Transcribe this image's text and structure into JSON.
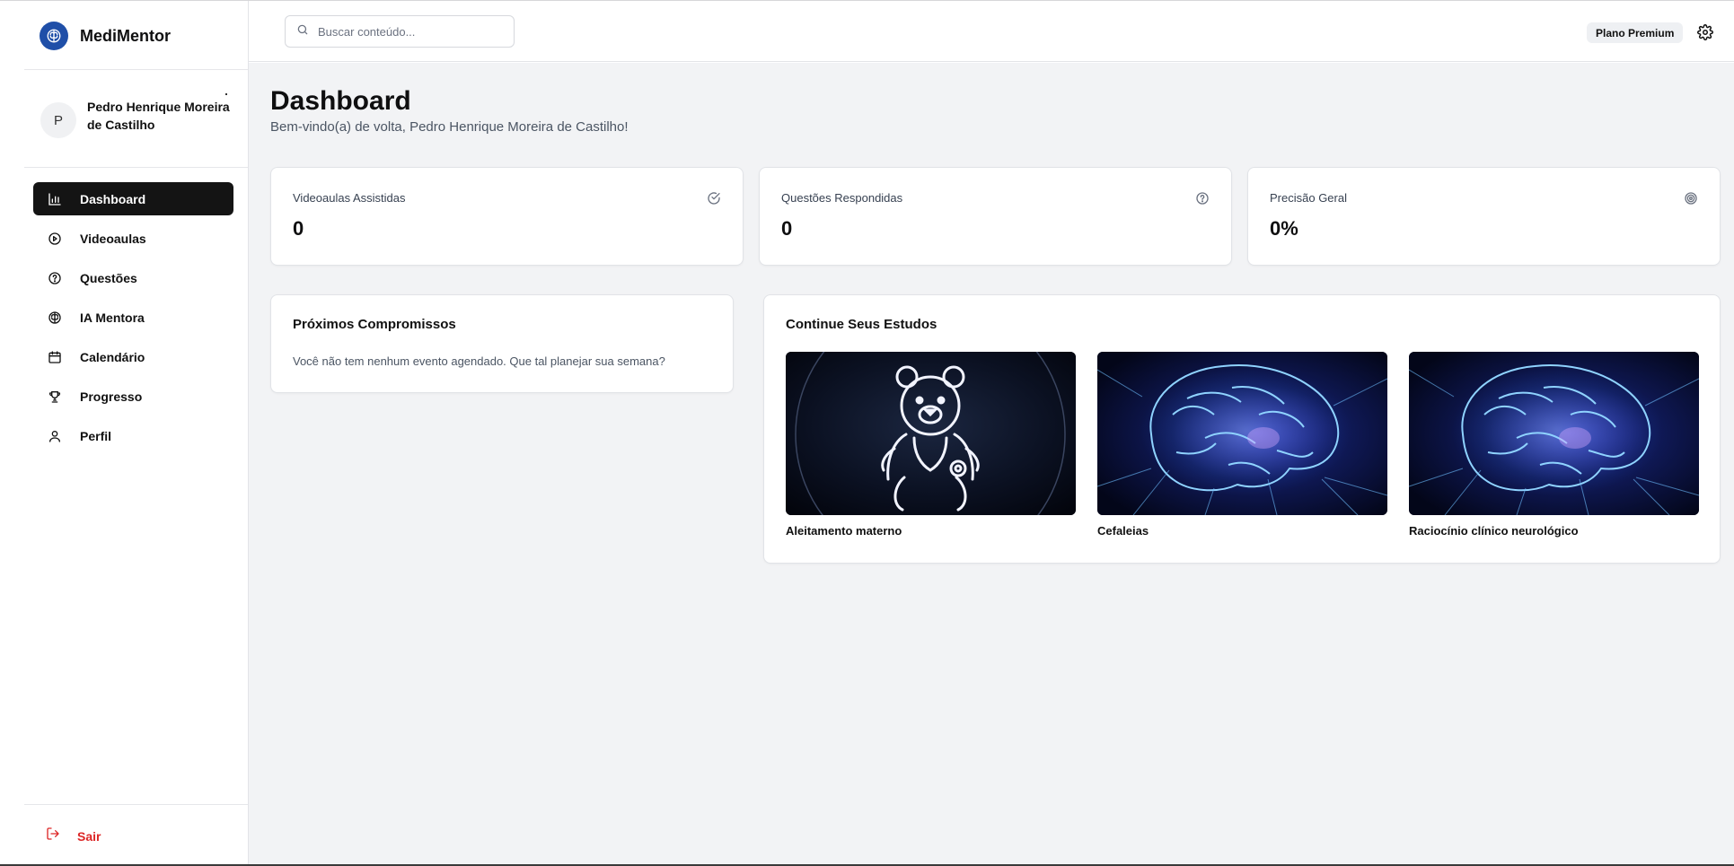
{
  "app": {
    "name": "MediMentor"
  },
  "user": {
    "initial": "P",
    "name": "Pedro Henrique Moreira de Castilho"
  },
  "nav": [
    {
      "label": "Dashboard",
      "icon": "bar-chart-icon",
      "active": true
    },
    {
      "label": "Videoaulas",
      "icon": "play-circle-icon",
      "active": false
    },
    {
      "label": "Questões",
      "icon": "help-circle-icon",
      "active": false
    },
    {
      "label": "IA Mentora",
      "icon": "brain-icon",
      "active": false
    },
    {
      "label": "Calendário",
      "icon": "calendar-icon",
      "active": false
    },
    {
      "label": "Progresso",
      "icon": "trophy-icon",
      "active": false
    },
    {
      "label": "Perfil",
      "icon": "user-icon",
      "active": false
    }
  ],
  "logout": {
    "label": "Sair",
    "icon": "logout-icon"
  },
  "header": {
    "search_placeholder": "Buscar conteúdo...",
    "plan_badge": "Plano Premium"
  },
  "page": {
    "title": "Dashboard",
    "subtitle": "Bem-vindo(a) de volta, Pedro Henrique Moreira de Castilho!"
  },
  "stats": [
    {
      "label": "Videoaulas Assistidas",
      "value": "0",
      "icon": "check-circle-icon"
    },
    {
      "label": "Questões Respondidas",
      "value": "0",
      "icon": "help-circle-icon"
    },
    {
      "label": "Precisão Geral",
      "value": "0%",
      "icon": "target-icon"
    }
  ],
  "appointments": {
    "title": "Próximos Compromissos",
    "empty_text": "Você não tem nenhum evento agendado. Que tal planejar sua semana?"
  },
  "continue_studies": {
    "title": "Continue Seus Estudos",
    "items": [
      {
        "title": "Aleitamento materno",
        "image": "teddy-bear-stethoscope-image"
      },
      {
        "title": "Cefaleias",
        "image": "brain-neon-image"
      },
      {
        "title": "Raciocínio clínico neurológico",
        "image": "brain-neon-image"
      }
    ]
  },
  "colors": {
    "brand": "#1f4fa8",
    "active_nav": "#141414",
    "logout": "#dc2626",
    "background": "#f2f3f5"
  }
}
